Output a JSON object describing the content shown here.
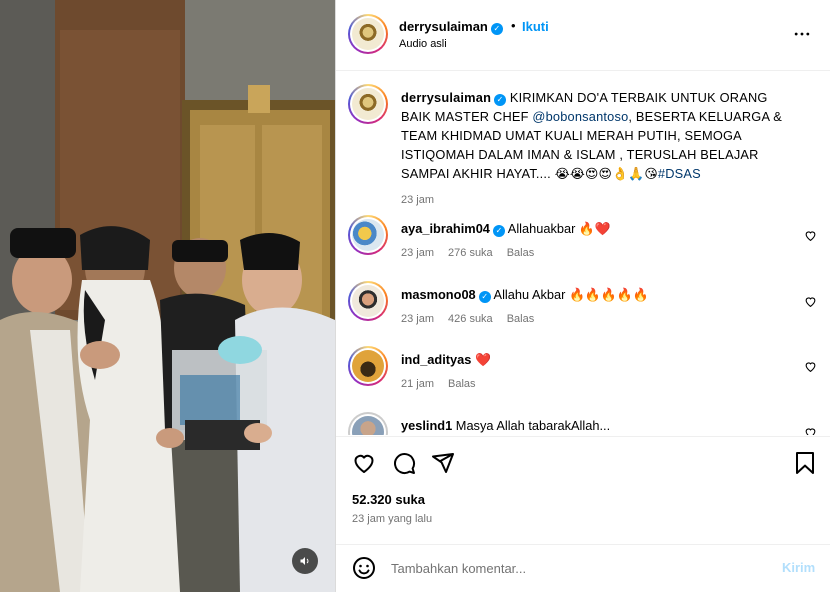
{
  "post": {
    "username": "derrysulaiman",
    "follow_label": "Ikuti",
    "dot": "•",
    "audio": "Audio asli",
    "more_label": "•••"
  },
  "caption": {
    "username": "derrysulaiman",
    "text_before": "KIRIMKAN DO'A TERBAIK UNTUK ORANG BAIK MASTER CHEF ",
    "mention": "@bobonsantoso",
    "text_after": ", BESERTA KELUARGA & TEAM KHIDMAD UMAT KUALI MERAH PUTIH, SEMOGA ISTIQOMAH DALAM IMAN & ISLAM , TERUSLAH BELAJAR SAMPAI AKHIR HAYAT.... 😭😭😍😍👌🙏😘",
    "hashtag": "#DSAS",
    "time": "23 jam"
  },
  "comments": [
    {
      "username": "aya_ibrahim04",
      "verified": true,
      "text": "Allahuakbar 🔥❤️",
      "time": "23 jam",
      "likes": "276 suka",
      "reply": "Balas"
    },
    {
      "username": "masmono08",
      "verified": true,
      "text": "Allahu Akbar 🔥🔥🔥🔥🔥",
      "time": "23 jam",
      "likes": "426 suka",
      "reply": "Balas"
    },
    {
      "username": "ind_adityas",
      "verified": false,
      "text": "❤️",
      "time": "21 jam",
      "likes": "",
      "reply": "Balas"
    },
    {
      "username": "yeslind1",
      "verified": false,
      "text": "Masya Allah tabarakAllah...",
      "time": "",
      "likes": "",
      "reply": ""
    }
  ],
  "footer": {
    "likes": "52.320 suka",
    "posted": "23 jam yang lalu"
  },
  "composer": {
    "placeholder": "Tambahkan komentar...",
    "send_label": "Kirim"
  },
  "colors": {
    "accent": "#0095f6",
    "send_disabled": "#b2dffc",
    "meta": "#737373",
    "heart_red": "#ed4956"
  },
  "icons": [
    "heart-icon",
    "comment-icon",
    "share-icon",
    "bookmark-icon",
    "emoji-icon",
    "mute-icon",
    "verified-icon",
    "more-icon"
  ]
}
